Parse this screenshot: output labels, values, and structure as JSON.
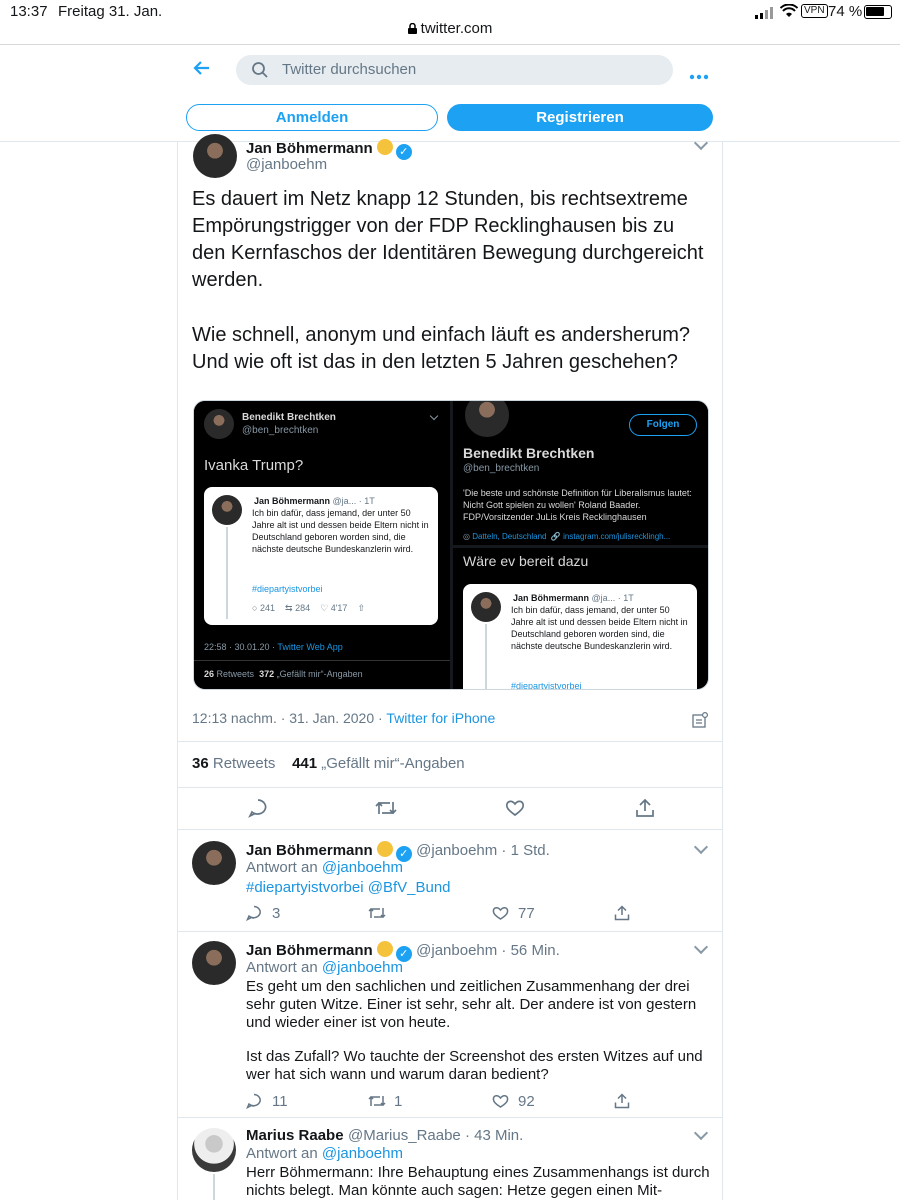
{
  "status_bar": {
    "time": "13:37",
    "date": "Freitag 31. Jan.",
    "vpn": "VPN",
    "battery": "74 %"
  },
  "browser": {
    "url": "twitter.com"
  },
  "header": {
    "search_placeholder": "Twitter durchsuchen",
    "login": "Anmelden",
    "register": "Registrieren"
  },
  "tweet": {
    "author": "Jan Böhmermann",
    "handle": "@janboehm",
    "text_p1": "Es dauert im Netz knapp 12 Stunden, bis rechtsextreme Empörungstrigger von der FDP Recklinghausen bis zu den Kernfaschos der Identitären Bewegung durchgereicht werden.",
    "text_p2": "Wie schnell, anonym und einfach läuft es andersherum? Und wie oft ist das in den letzten 5 Jahren geschehen?",
    "timestamp": "12:13 nachm. · 31. Jan. 2020 · ",
    "source": "Twitter for iPhone",
    "retweets_count": "36",
    "retweets_label": "Retweets",
    "likes_count": "441",
    "likes_label": "„Gefällt mir“-Angaben"
  },
  "media": {
    "left": {
      "name": "Benedikt Brechtken",
      "handle": "@ben_brechtken",
      "text": "Ivanka Trump?",
      "quoted_name": "Jan Böhmermann",
      "quoted_meta": "@ja... · 1T",
      "quoted_text": "Ich bin dafür, dass jemand, der unter 50 Jahre alt ist und dessen beide Eltern nicht in Deutschland geboren worden sind, die nächste deutsche Bundeskanzlerin wird.",
      "quoted_hashtag": "#diepartyistvorbei",
      "q_replies": "241",
      "q_retweets": "284",
      "q_likes": "4'17",
      "time": "22:58 · 30.01.20 · ",
      "source": "Twitter Web App",
      "rt_count": "26",
      "rt_label": "Retweets",
      "likes_count": "372",
      "likes_label": "„Gefällt mir“-Angaben"
    },
    "right_top": {
      "follow": "Folgen",
      "name": "Benedikt Brechtken",
      "handle": "@ben_brechtken",
      "bio": "'Die beste und schönste Definition für Liberalismus lautet: Nicht Gott spielen zu wollen' Roland Baader. FDP/Vorsitzender JuLis Kreis Recklinghausen",
      "location": "Datteln, Deutschland",
      "url": "instagram.com/julisrecklingh..."
    },
    "right_bottom": {
      "text": "Wäre ev bereit dazu",
      "quoted_name": "Jan Böhmermann",
      "quoted_meta": "@ja... · 1T",
      "quoted_text": "Ich bin dafür, dass jemand, der unter 50 Jahre alt ist und dessen beide Eltern nicht in Deutschland geboren worden sind, die nächste deutsche Bundeskanzlerin wird.",
      "quoted_hashtag": "#diepartyistvorbei"
    }
  },
  "replies": [
    {
      "name": "Jan Böhmermann",
      "meta": "@janboehm · 1 Std.",
      "reply_prefix": "Antwort an ",
      "reply_to": "@janboehm",
      "text": "#diepartyistvorbei @BfV_Bund",
      "replies": "3",
      "retweets": "",
      "likes": "77"
    },
    {
      "name": "Jan Böhmermann",
      "meta": "@janboehm · 56 Min.",
      "reply_prefix": "Antwort an ",
      "reply_to": "@janboehm",
      "text_p1": "Es geht um den sachlichen und zeitlichen Zusammenhang der drei sehr guten Witze. Einer ist sehr, sehr alt. Der andere ist von gestern und wieder einer ist von heute.",
      "text_p2": "Ist das Zufall? Wo tauchte der Screenshot des ersten Witzes auf und wer hat sich wann und warum daran bedient?",
      "replies": "11",
      "retweets": "1",
      "likes": "92"
    },
    {
      "name": "Marius Raabe",
      "meta": "@Marius_Raabe · 43 Min.",
      "reply_prefix": "Antwort an ",
      "reply_to": "@janboehm",
      "text": "Herr Böhmermann: Ihre Behauptung eines Zusammenhangs ist durch nichts belegt. Man könnte auch sagen: Hetze gegen einen Mit-"
    }
  ],
  "colors": {
    "accent": "#1da1f2",
    "link": "#1b95e0",
    "muted": "#657786"
  }
}
